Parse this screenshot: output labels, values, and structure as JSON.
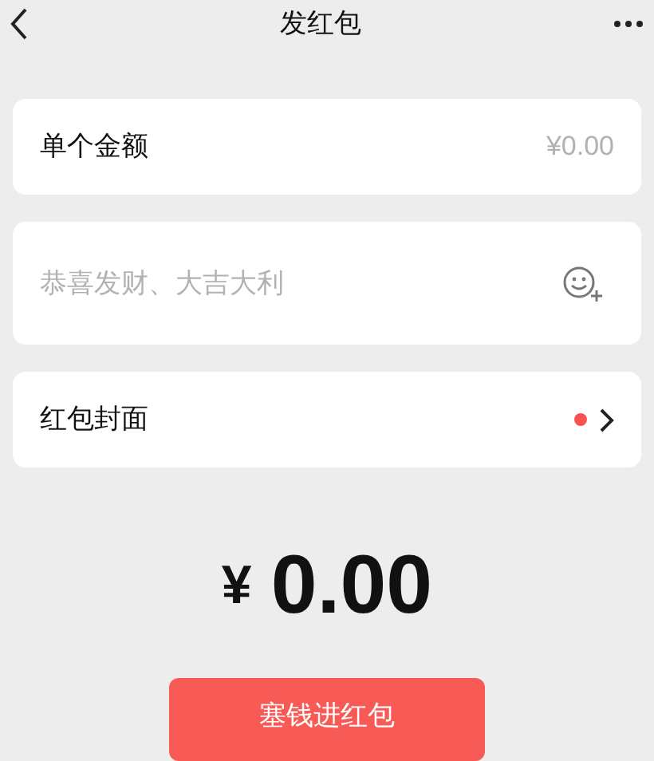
{
  "header": {
    "title": "发红包"
  },
  "amount_field": {
    "label": "单个金额",
    "placeholder": "¥0.00"
  },
  "greeting_field": {
    "placeholder": "恭喜发财、大吉大利"
  },
  "cover_row": {
    "label": "红包封面",
    "has_new": true
  },
  "total": {
    "currency": "¥",
    "amount": "0.00"
  },
  "submit_button": {
    "label": "塞钱进红包"
  }
}
